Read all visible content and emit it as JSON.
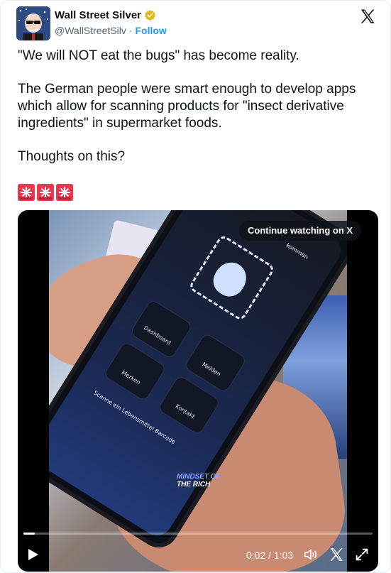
{
  "author": {
    "display_name": "Wall Street Silver",
    "handle": "@WallStreetSilv",
    "separator": "·",
    "follow_label": "Follow"
  },
  "tweet": {
    "line1": "\"We will NOT eat the bugs\" has become reality.",
    "line2": "The German people were smart enough to develop apps which allow for scanning products for \"insect derivative ingredients\" in supermarket foods.",
    "line3": "Thoughts on this?",
    "sirens": [
      "🚨",
      "🚨",
      "🚨"
    ]
  },
  "video": {
    "continue_label": "Continue watching on X",
    "watermark_line1": "MINDSET OF",
    "watermark_line2": "THE RICH",
    "phone_texts": {
      "dashboard": "Dashboard",
      "melden": "Melden",
      "merken": "Merken",
      "kontakt": "Kontakt",
      "scan": "Scanne ein Lebensmittel Barcode",
      "willkommen": "kommen"
    },
    "time_display": "0:02 / 1:03",
    "progress_fraction": 0.032
  },
  "icons": {
    "play": "play-icon",
    "volume": "volume-icon",
    "x": "x-logo-icon",
    "fullscreen": "fullscreen-icon",
    "verified": "verified-badge-icon"
  },
  "colors": {
    "follow": "#1d9bf0",
    "verified": "#e2b719",
    "text": "#0f1419",
    "muted": "#536471"
  }
}
